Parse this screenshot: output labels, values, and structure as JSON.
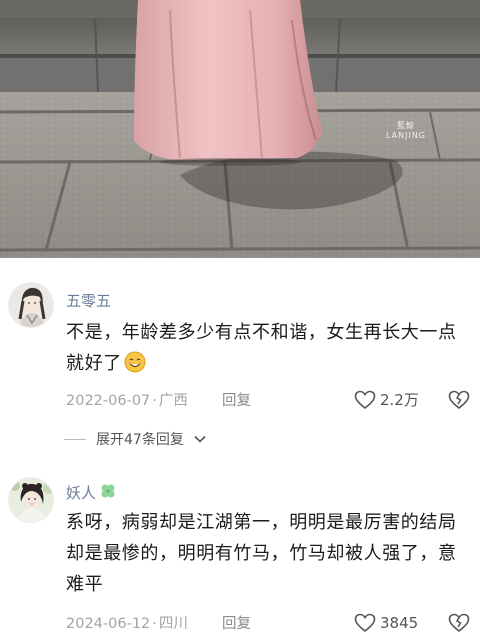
{
  "photo": {
    "watermark_line1": "藍鯨",
    "watermark_line2": "LANJING"
  },
  "comments": [
    {
      "username": "五零五",
      "text": "不是，年龄差多少有点不和谐，女生再长大一点就好了",
      "emoji": "smiling-face-emoji",
      "date": "2022-06-07",
      "location": "广西",
      "reply_label": "回复",
      "likes": "2.2万",
      "expand_label": "展开47条回复"
    },
    {
      "username": "妖人",
      "username_badge": "clover-icon",
      "text": "系呀，病弱却是江湖第一，明明是最厉害的结局却是最惨的，明明有竹马，竹马却被人强了，意难平",
      "date": "2024-06-12",
      "location": "四川",
      "reply_label": "回复",
      "likes": "3845"
    }
  ],
  "separator": "·",
  "colors": {
    "username": "#6c7e96",
    "meta": "#a4a4a4",
    "text": "#1b1b1b",
    "skirt": "#e8b4b6"
  }
}
